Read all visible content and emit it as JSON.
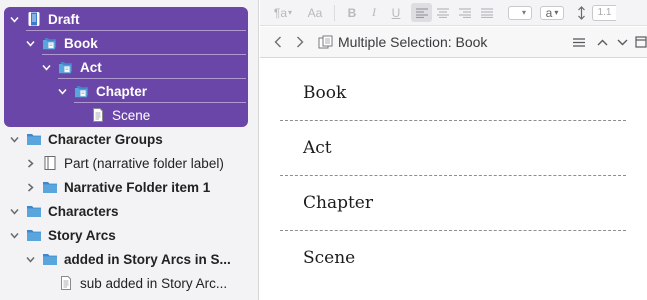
{
  "binder": {
    "items": [
      {
        "label": "Draft",
        "bold": true,
        "selected": true,
        "depth": 0,
        "chevron": "down",
        "icon": "draft-icon"
      },
      {
        "label": "Book",
        "bold": true,
        "selected": true,
        "depth": 1,
        "chevron": "down",
        "icon": "folder-stack-icon"
      },
      {
        "label": "Act",
        "bold": true,
        "selected": true,
        "depth": 2,
        "chevron": "down",
        "icon": "folder-stack-icon"
      },
      {
        "label": "Chapter",
        "bold": true,
        "selected": true,
        "depth": 3,
        "chevron": "down",
        "icon": "folder-stack-icon"
      },
      {
        "label": "Scene",
        "bold": false,
        "selected": true,
        "depth": 4,
        "chevron": "none",
        "icon": "document-icon"
      },
      {
        "label": "Character Groups",
        "bold": true,
        "selected": false,
        "depth": 0,
        "chevron": "down",
        "icon": "folder-icon"
      },
      {
        "label": "Part (narrative folder label)",
        "bold": false,
        "selected": false,
        "depth": 1,
        "chevron": "right",
        "icon": "page-icon"
      },
      {
        "label": "Narrative Folder item 1",
        "bold": true,
        "selected": false,
        "depth": 1,
        "chevron": "right",
        "icon": "folder-icon"
      },
      {
        "label": "Characters",
        "bold": true,
        "selected": false,
        "depth": 0,
        "chevron": "down",
        "icon": "folder-icon"
      },
      {
        "label": "Story Arcs",
        "bold": true,
        "selected": false,
        "depth": 0,
        "chevron": "down",
        "icon": "folder-icon"
      },
      {
        "label": "added in Story Arcs in S...",
        "bold": true,
        "selected": false,
        "depth": 1,
        "chevron": "down",
        "icon": "folder-icon"
      },
      {
        "label": "sub added in Story Arc...",
        "bold": false,
        "selected": false,
        "depth": 2,
        "chevron": "none",
        "icon": "document-icon"
      }
    ]
  },
  "format_bar": {
    "paragraph_style": "¶a",
    "font_style": "Aa",
    "bold": "B",
    "italic": "I",
    "underline": "U",
    "text_color": "a",
    "line_spacing": "1.1"
  },
  "nav_bar": {
    "title": "Multiple Selection: Book"
  },
  "document": {
    "sections": [
      "Book",
      "Act",
      "Chapter",
      "Scene"
    ]
  },
  "colors": {
    "selection": "#6a46a8",
    "folder_blue": "#5aa5dc",
    "background": "#f3f3f5"
  }
}
